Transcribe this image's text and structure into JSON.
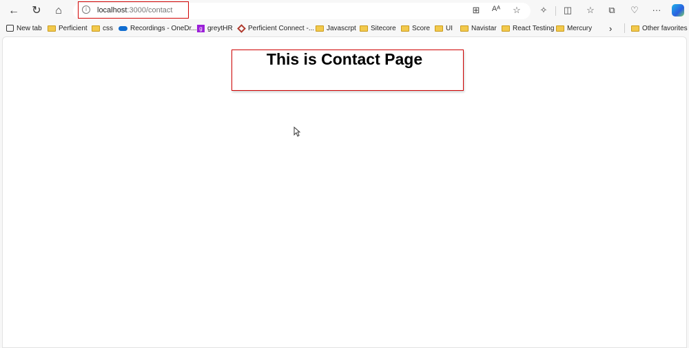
{
  "browser": {
    "url_host": "localhost",
    "url_path": ":3000/contact",
    "bookmarks": [
      {
        "label": "New tab",
        "icon": "new-tab-icon"
      },
      {
        "label": "Perficient",
        "icon": "folder-icon"
      },
      {
        "label": "css",
        "icon": "folder-icon"
      },
      {
        "label": "Recordings - OneDr...",
        "icon": "onedrive-icon"
      },
      {
        "label": "greytHR",
        "icon": "greythr-icon"
      },
      {
        "label": "Perficient Connect -...",
        "icon": "perficient-icon"
      },
      {
        "label": "Javascrpt",
        "icon": "folder-icon"
      },
      {
        "label": "Sitecore",
        "icon": "folder-icon"
      },
      {
        "label": "Score",
        "icon": "folder-icon"
      },
      {
        "label": "UI",
        "icon": "folder-icon"
      },
      {
        "label": "Navistar",
        "icon": "folder-icon"
      },
      {
        "label": "React Testing",
        "icon": "folder-icon"
      },
      {
        "label": "Mercury",
        "icon": "folder-icon"
      }
    ],
    "other_favorites": "Other favorites"
  },
  "page": {
    "heading": "This is Contact Page"
  }
}
